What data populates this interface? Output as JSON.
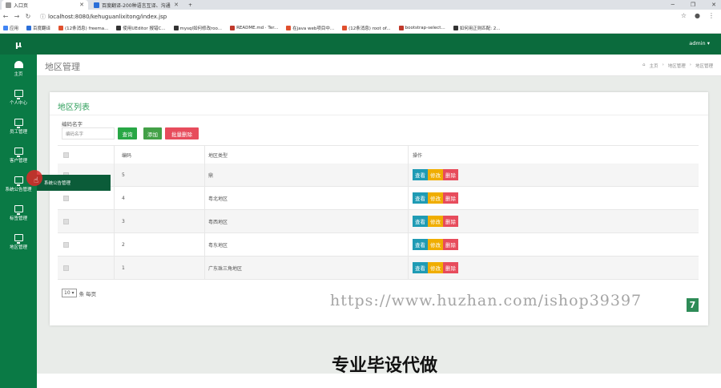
{
  "browser": {
    "tabs": [
      {
        "label": "入口页",
        "color": "#999999"
      },
      {
        "label": "百度翻译-200种语言互译、沟通",
        "color": "#2b6fd8"
      }
    ],
    "new_tab": "+",
    "url": "localhost:8080/kehuguanlixitong/index.jsp",
    "bookmarks": [
      {
        "label": "应用",
        "color": "#4285f4"
      },
      {
        "label": "百度翻译",
        "color": "#2b6fd8"
      },
      {
        "label": "(12条消息) freema...",
        "color": "#e0502e"
      },
      {
        "label": "使用UEditor 报错C...",
        "color": "#333333"
      },
      {
        "label": "mysql如何修改roo...",
        "color": "#333333"
      },
      {
        "label": "README.md · Ter...",
        "color": "#c0392b"
      },
      {
        "label": "在java web项目中...",
        "color": "#e0502e"
      },
      {
        "label": "(12条消息) root of...",
        "color": "#e0502e"
      },
      {
        "label": "bootstrap-select...",
        "color": "#c0392b"
      },
      {
        "label": "如何用正则匹配: 2...",
        "color": "#333333"
      }
    ]
  },
  "sidebar": {
    "brand": "μ",
    "items": [
      {
        "label": "主页",
        "icon": "dashboard-icon"
      },
      {
        "label": "个人中心",
        "icon": "monitor-icon"
      },
      {
        "label": "员工管理",
        "icon": "monitor-icon"
      },
      {
        "label": "客户管理",
        "icon": "monitor-icon"
      },
      {
        "label": "系统公告管理",
        "icon": "monitor-icon"
      },
      {
        "label": "标签管理",
        "icon": "monitor-icon"
      },
      {
        "label": "地区管理",
        "icon": "monitor-icon"
      }
    ],
    "tooltip": "系统公告管理"
  },
  "topnav": {
    "user": "admin ▾"
  },
  "page": {
    "title": "地区管理",
    "breadcrumb": [
      "主页",
      "地区管理",
      "地区管理"
    ]
  },
  "card": {
    "title": "地区列表",
    "filter_label": "编码名字",
    "filter_placeholder": "编码名字",
    "buttons": {
      "search": "查询",
      "add": "添加",
      "batch_delete": "批量删除"
    },
    "columns": [
      "编码",
      "地区类型",
      "操作"
    ],
    "rows": [
      {
        "code": "5",
        "type": "鼎"
      },
      {
        "code": "4",
        "type": "粤北地区"
      },
      {
        "code": "3",
        "type": "粤西地区"
      },
      {
        "code": "2",
        "type": "粤东地区"
      },
      {
        "code": "1",
        "type": "广东珠三角地区"
      }
    ],
    "actions": {
      "view": "查看",
      "edit": "修改",
      "delete": "删除"
    },
    "page_size": "10",
    "page_size_suffix": "条 每页"
  },
  "colors": {
    "sidebar": "#0a7a45",
    "topnav": "#0b6b3d",
    "search": "#28a745",
    "add": "#43a047",
    "delete": "#e74c5c",
    "view": "#1f9bb4",
    "edit": "#f0ad00"
  },
  "watermark": {
    "text": "https://www.huzhan.com/ishop39397",
    "badge": "7"
  },
  "promo": "专业毕设代做"
}
